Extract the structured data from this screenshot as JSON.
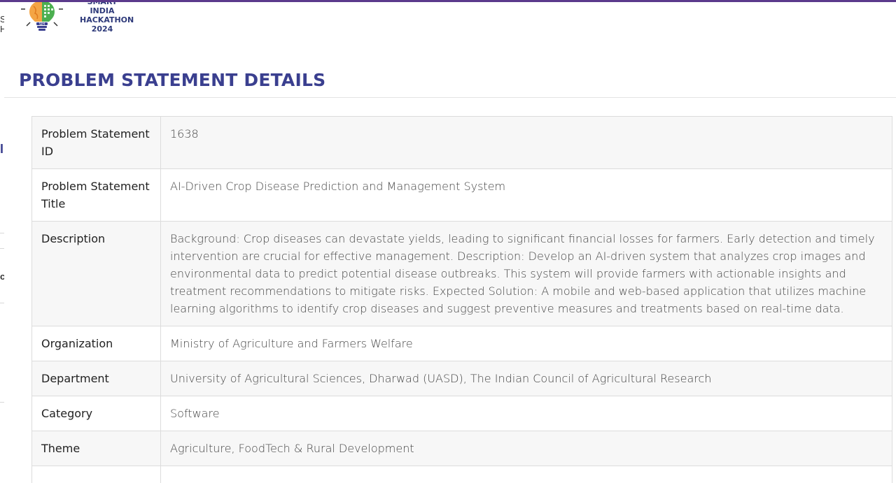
{
  "logo": {
    "lines": [
      "SMART INDIA",
      "HACKATHON",
      "2024"
    ],
    "badge": "SIH"
  },
  "background_fragments": [
    "S",
    "H",
    "I",
    "c"
  ],
  "page_title": "PROBLEM STATEMENT DETAILS",
  "rows": [
    {
      "label": "Problem Statement ID",
      "value": "1638"
    },
    {
      "label": "Problem Statement Title",
      "value": "AI-Driven Crop Disease Prediction and Management System"
    },
    {
      "label": "Description",
      "value": "Background: Crop diseases can devastate yields, leading to significant financial losses for farmers. Early detection and timely intervention are crucial for effective management. Description: Develop an AI-driven system that analyzes crop images and environmental data to predict potential disease outbreaks. This system will provide farmers with actionable insights and treatment recommendations to mitigate risks. Expected Solution: A mobile and web-based application that utilizes machine learning algorithms to identify crop diseases and suggest preventive measures and treatments based on real-time data."
    },
    {
      "label": "Organization",
      "value": "Ministry of Agriculture and Farmers Welfare"
    },
    {
      "label": "Department",
      "value": "University of Agricultural Sciences, Dharwad (UASD), The Indian Council of Agricultural Research"
    },
    {
      "label": "Category",
      "value": "Software"
    },
    {
      "label": "Theme",
      "value": "Agriculture, FoodTech & Rural Development"
    },
    {
      "label": "",
      "value": ""
    }
  ],
  "colors": {
    "title": "#3a3f8f",
    "top_bar": "#5b3a8c",
    "overlay": "#7a7a7a"
  }
}
